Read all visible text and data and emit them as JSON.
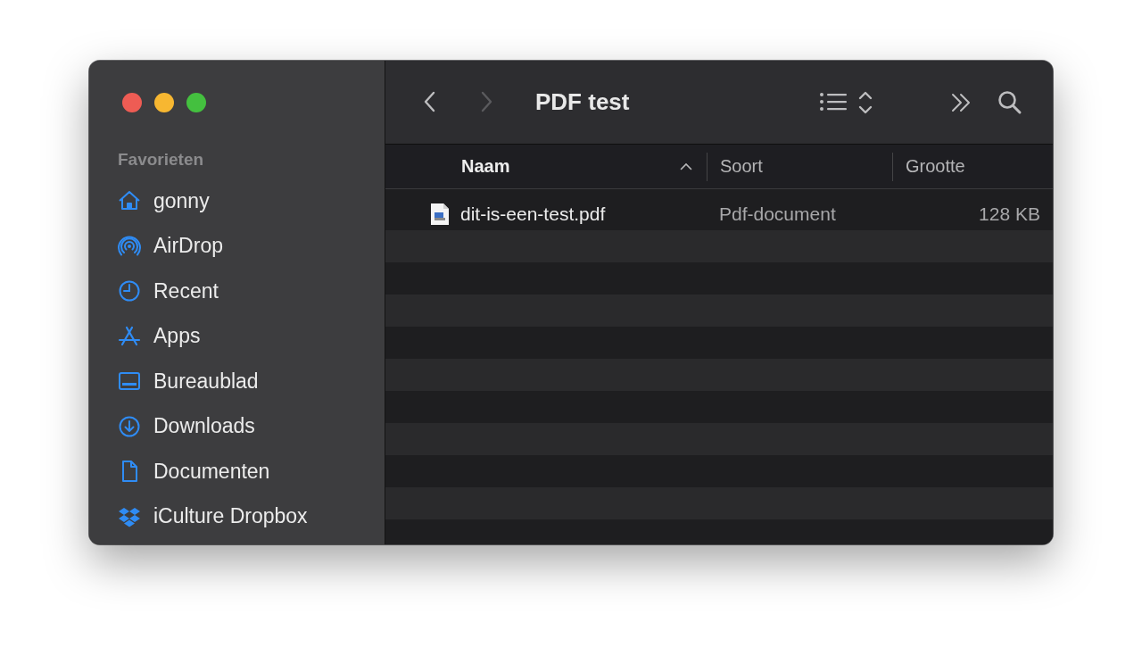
{
  "window": {
    "title": "PDF test"
  },
  "navigation": [
    {
      "kind": "back",
      "disabled": false
    },
    {
      "kind": "forward",
      "disabled": true
    }
  ],
  "sidebar": {
    "section": "Favorieten",
    "items": [
      {
        "label": "gonny"
      },
      {
        "label": "AirDrop"
      },
      {
        "label": "Recent"
      },
      {
        "label": "Apps"
      },
      {
        "label": "Bureaublad"
      },
      {
        "label": "Downloads"
      },
      {
        "label": "Documenten"
      },
      {
        "label": "iCulture Dropbox"
      }
    ]
  },
  "table": {
    "columns": [
      {
        "label": "Naam",
        "sorted": true
      },
      {
        "label": "Soort",
        "sorted": false
      },
      {
        "label": "Grootte",
        "sorted": false
      }
    ],
    "rows": [
      {
        "name": "dit-is-een-test.pdf",
        "kind": "Pdf-document",
        "size": "128 KB"
      }
    ]
  }
}
